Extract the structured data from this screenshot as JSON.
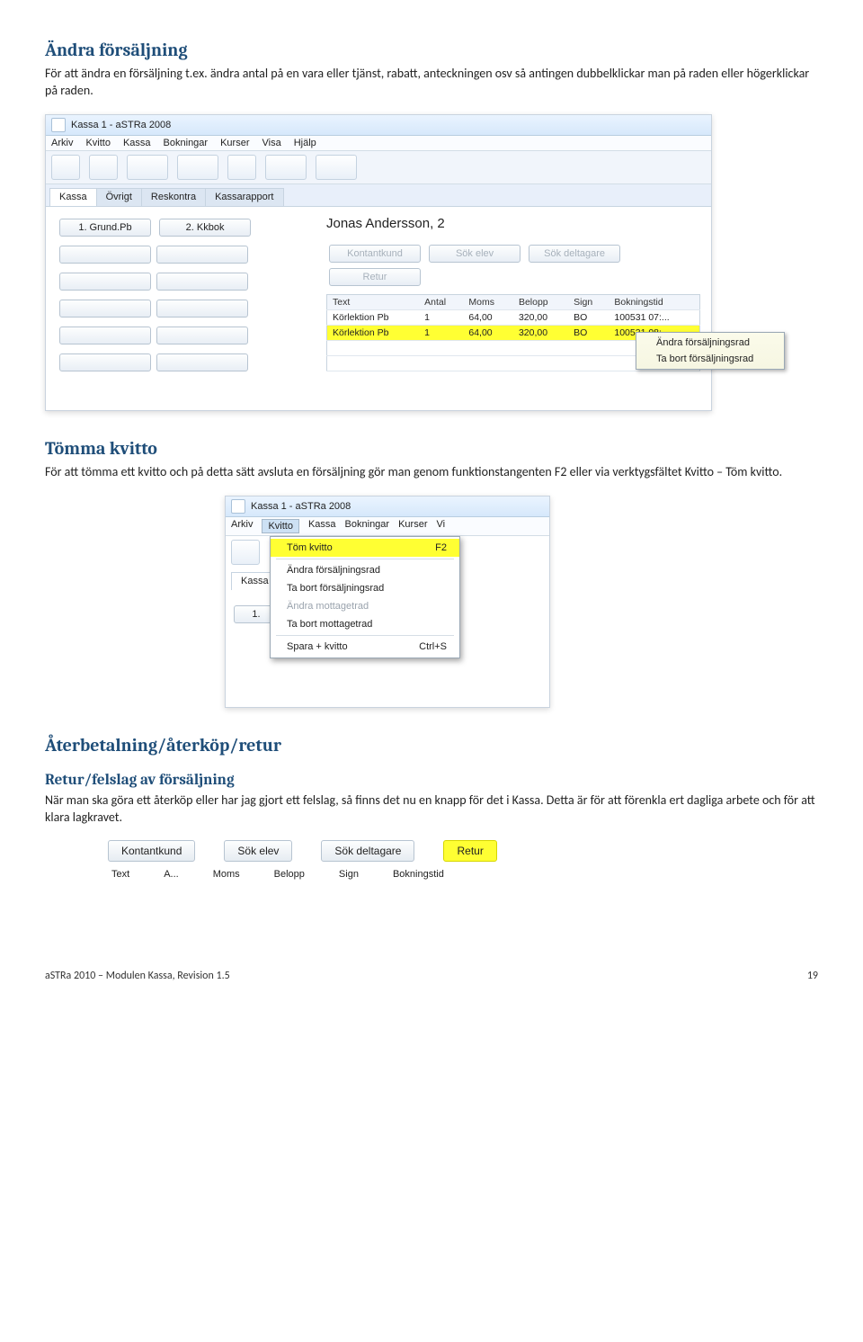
{
  "section1": {
    "heading": "Ändra försäljning",
    "body": "För att ändra en försäljning t.ex. ändra antal på en vara eller tjänst, rabatt, anteckningen osv så antingen dubbelklickar man på raden eller högerklickar på raden."
  },
  "fig1": {
    "title": "Kassa 1  -  aSTRa 2008",
    "menu": [
      "Arkiv",
      "Kvitto",
      "Kassa",
      "Bokningar",
      "Kurser",
      "Visa",
      "Hjälp"
    ],
    "tabs": [
      "Kassa",
      "Övrigt",
      "Reskontra",
      "Kassarapport"
    ],
    "gbuttons": [
      "1. Grund.Pb",
      "2. Kkbok"
    ],
    "customer": "Jonas Andersson, 2",
    "actions": [
      "Kontantkund",
      "Sök elev",
      "Sök deltagare",
      "Retur"
    ],
    "gridcols": [
      "Text",
      "Antal",
      "Moms",
      "Belopp",
      "Sign",
      "Bokningstid"
    ],
    "rows": [
      {
        "c": [
          "Körlektion Pb",
          "1",
          "64,00",
          "320,00",
          "BO",
          "100531 07:..."
        ],
        "hl": false
      },
      {
        "c": [
          "Körlektion Pb",
          "1",
          "64,00",
          "320,00",
          "BO",
          "100531 08:..."
        ],
        "hl": true
      }
    ],
    "ctx": [
      "Ändra försäljningsrad",
      "Ta bort försäljningsrad"
    ]
  },
  "section2": {
    "heading": "Tömma kvitto",
    "body": "För att tömma ett kvitto och på detta sätt avsluta en försäljning gör man genom funktionstangenten F2 eller via verktygsfältet Kvitto – Töm kvitto."
  },
  "fig2": {
    "title": "Kassa 1  -  aSTRa 2008",
    "menu": [
      "Arkiv",
      "Kvitto",
      "Kassa",
      "Bokningar",
      "Kurser",
      "Vi"
    ],
    "tab": "Kassa",
    "smallbtn": "1.",
    "dropdown": [
      {
        "label": "Töm kvitto",
        "sc": "F2",
        "hl": true,
        "dis": false
      },
      {
        "label": "Ändra försäljningsrad",
        "dis": false
      },
      {
        "label": "Ta bort försäljningsrad",
        "dis": false
      },
      {
        "label": "Ändra mottagetrad",
        "dis": true
      },
      {
        "label": "Ta bort mottagetrad",
        "dis": false
      },
      {
        "label": "Spara + kvitto",
        "sc": "Ctrl+S",
        "dis": false
      }
    ]
  },
  "section3": {
    "heading": "Återbetalning/återköp/retur",
    "sub": "Retur/felslag av försäljning",
    "body": "När man ska göra ett återköp eller har jag gjort ett felslag, så finns det nu en knapp för det i Kassa. Detta är för att förenkla ert dagliga arbete och för att klara lagkravet."
  },
  "fig3": {
    "buttons": [
      {
        "t": "Kontantkund",
        "hl": false
      },
      {
        "t": "Sök elev",
        "hl": false
      },
      {
        "t": "Sök deltagare",
        "hl": false
      },
      {
        "t": "Retur",
        "hl": true
      }
    ],
    "cols": [
      "Text",
      "A...",
      "Moms",
      "Belopp",
      "Sign",
      "Bokningstid"
    ]
  },
  "footer": {
    "left": "aSTRa 2010 – Modulen Kassa, Revision 1.5",
    "right": "19"
  }
}
